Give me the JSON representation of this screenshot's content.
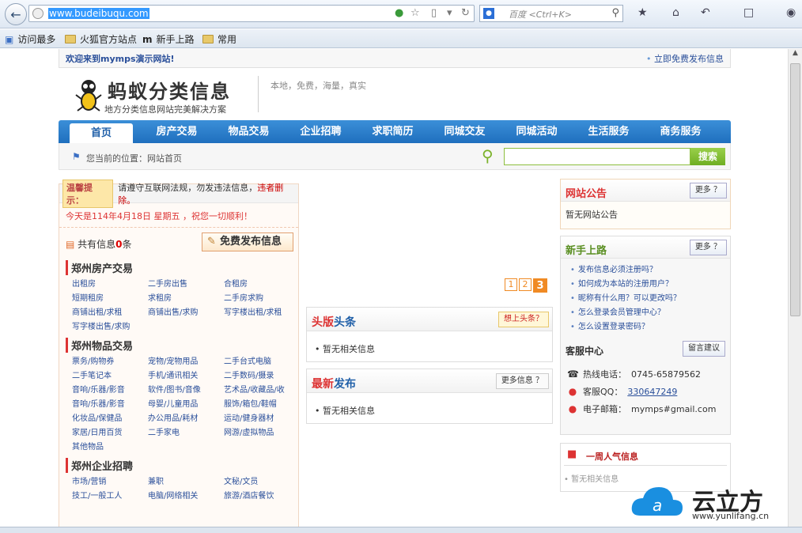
{
  "browser": {
    "url": "www.budeibuqu.com",
    "search_placeholder": "百度 <Ctrl+K>",
    "bookmarks": [
      "访问最多",
      "火狐官方站点",
      "新手上路",
      "常用"
    ]
  },
  "site": {
    "welcome": "欢迎来到mymps演示网站!",
    "post_free": "立即免费发布信息",
    "logo_title": "蚂蚁分类信息",
    "logo_sub": "地方分类信息网站完美解决方案",
    "slogan": "本地，免费，海量，真实",
    "nav": [
      "首页",
      "房产交易",
      "物品交易",
      "企业招聘",
      "求职简历",
      "同城交友",
      "同城活动",
      "生活服务",
      "商务服务"
    ],
    "location": "您当前的位置：网站首页",
    "search_button": "搜索"
  },
  "left": {
    "tip_tag": "温馨提示：",
    "tip_text": "请遵守互联网法规，勿发违法信息，",
    "tip_red": "违者删除。",
    "date": "今天是114年4月18日 星期五 ，祝您一切顺利！",
    "count_prefix": "共有信息",
    "count_value": "0",
    "count_suffix": "条",
    "free_post": "免费发布信息",
    "categories": [
      {
        "title": "郑州房产交易",
        "items": [
          "出租房",
          "二手房出售",
          "合租房",
          "短期租房",
          "求租房",
          "二手房求购",
          "商铺出租/求租",
          "商铺出售/求购",
          "写字楼出租/求租",
          "写字楼出售/求购"
        ]
      },
      {
        "title": "郑州物品交易",
        "items": [
          "票务/购物券",
          "宠物/宠物用品",
          "二手台式电脑",
          "二手笔记本",
          "手机/通讯相关",
          "二手数码/摄录",
          "音响/乐器/影音",
          "软件/图书/音像",
          "艺术品/收藏品/收",
          "音响/乐器/影音",
          "母婴/儿童用品",
          "服饰/箱包/鞋帽",
          "化妆品/保健品",
          "办公用品/耗材",
          "运动/健身器材",
          "家居/日用百货",
          "二手家电",
          "网游/虚拟物品",
          "其他物品"
        ]
      },
      {
        "title": "郑州企业招聘",
        "items": [
          "市场/营销",
          "兼职",
          "文秘/文员",
          "技工/一般工人",
          "电脑/网络相关",
          "旅游/酒店餐饮"
        ]
      }
    ]
  },
  "middle": {
    "pages": [
      "1",
      "2",
      "3"
    ],
    "headline_red": "头版",
    "headline_blue": "头条",
    "headline_btn": "想上头条？",
    "headline_empty": "暂无相关信息",
    "latest_red": "最新",
    "latest_blue": "发布",
    "latest_btn": "更多信息 ？",
    "latest_empty": "暂无相关信息"
  },
  "right": {
    "announce_title": "网站公告",
    "more": "更多 ？",
    "announce_empty": "暂无网站公告",
    "guide_title": "新手上路",
    "guide_items": [
      "发布信息必须注册吗？",
      "如何成为本站的注册用户？",
      "昵称有什么用？可以更改吗？",
      "怎么登录会员管理中心？",
      "怎么设置登录密码？"
    ],
    "service_title": "客服中心",
    "feedback": "留言建议",
    "phone_label": "热线电话：",
    "phone": "0745-65879562",
    "qq_label": "客服QQ：",
    "qq": "330647249",
    "email_label": "电子邮箱：",
    "email": "mymps#gmail.com",
    "popular_title": "一周人气信息",
    "popular_empty": "暂无相关信息"
  },
  "watermark": {
    "brand": "云立方",
    "site": "www.yunlifang.cn"
  }
}
